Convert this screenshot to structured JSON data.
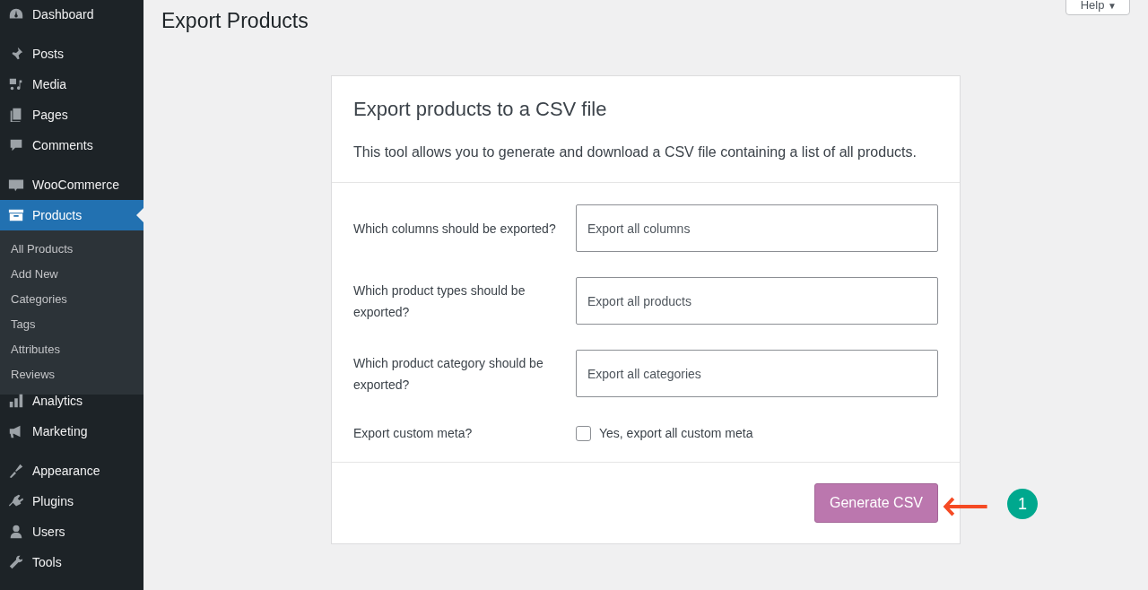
{
  "sidebar": {
    "groups": [
      {
        "items": [
          {
            "label": "Dashboard",
            "selected": false
          }
        ]
      },
      {
        "items": [
          {
            "label": "Posts",
            "selected": false
          },
          {
            "label": "Media",
            "selected": false
          },
          {
            "label": "Pages",
            "selected": false
          },
          {
            "label": "Comments",
            "selected": false
          }
        ]
      },
      {
        "items": [
          {
            "label": "WooCommerce",
            "selected": false
          },
          {
            "label": "Products",
            "selected": true,
            "children": [
              {
                "label": "All Products",
                "selected": false
              },
              {
                "label": "Add New",
                "selected": false
              },
              {
                "label": "Categories",
                "selected": false
              },
              {
                "label": "Tags",
                "selected": false
              },
              {
                "label": "Attributes",
                "selected": false
              },
              {
                "label": "Reviews",
                "selected": false
              }
            ]
          },
          {
            "label": "Analytics",
            "selected": false
          },
          {
            "label": "Marketing",
            "selected": false
          }
        ]
      },
      {
        "items": [
          {
            "label": "Appearance",
            "selected": false
          },
          {
            "label": "Plugins",
            "selected": false
          },
          {
            "label": "Users",
            "selected": false
          },
          {
            "label": "Tools",
            "selected": false
          }
        ]
      }
    ]
  },
  "page": {
    "title": "Export Products",
    "help_button": "Help",
    "help_caret": "▼"
  },
  "card": {
    "title": "Export products to a CSV file",
    "description": "This tool allows you to generate and download a CSV file containing a list of all products.",
    "fields": [
      {
        "kind": "select",
        "label": "Which columns should be exported?",
        "placeholder": "Export all columns"
      },
      {
        "kind": "select",
        "label": "Which product types should be exported?",
        "placeholder": "Export all products"
      },
      {
        "kind": "select",
        "label": "Which product category should be exported?",
        "placeholder": "Export all categories"
      },
      {
        "kind": "checkbox",
        "label": "Export custom meta?",
        "option": "Yes, export all custom meta",
        "checked": false
      }
    ],
    "button": "Generate CSV"
  },
  "annotation": {
    "number": "1"
  }
}
